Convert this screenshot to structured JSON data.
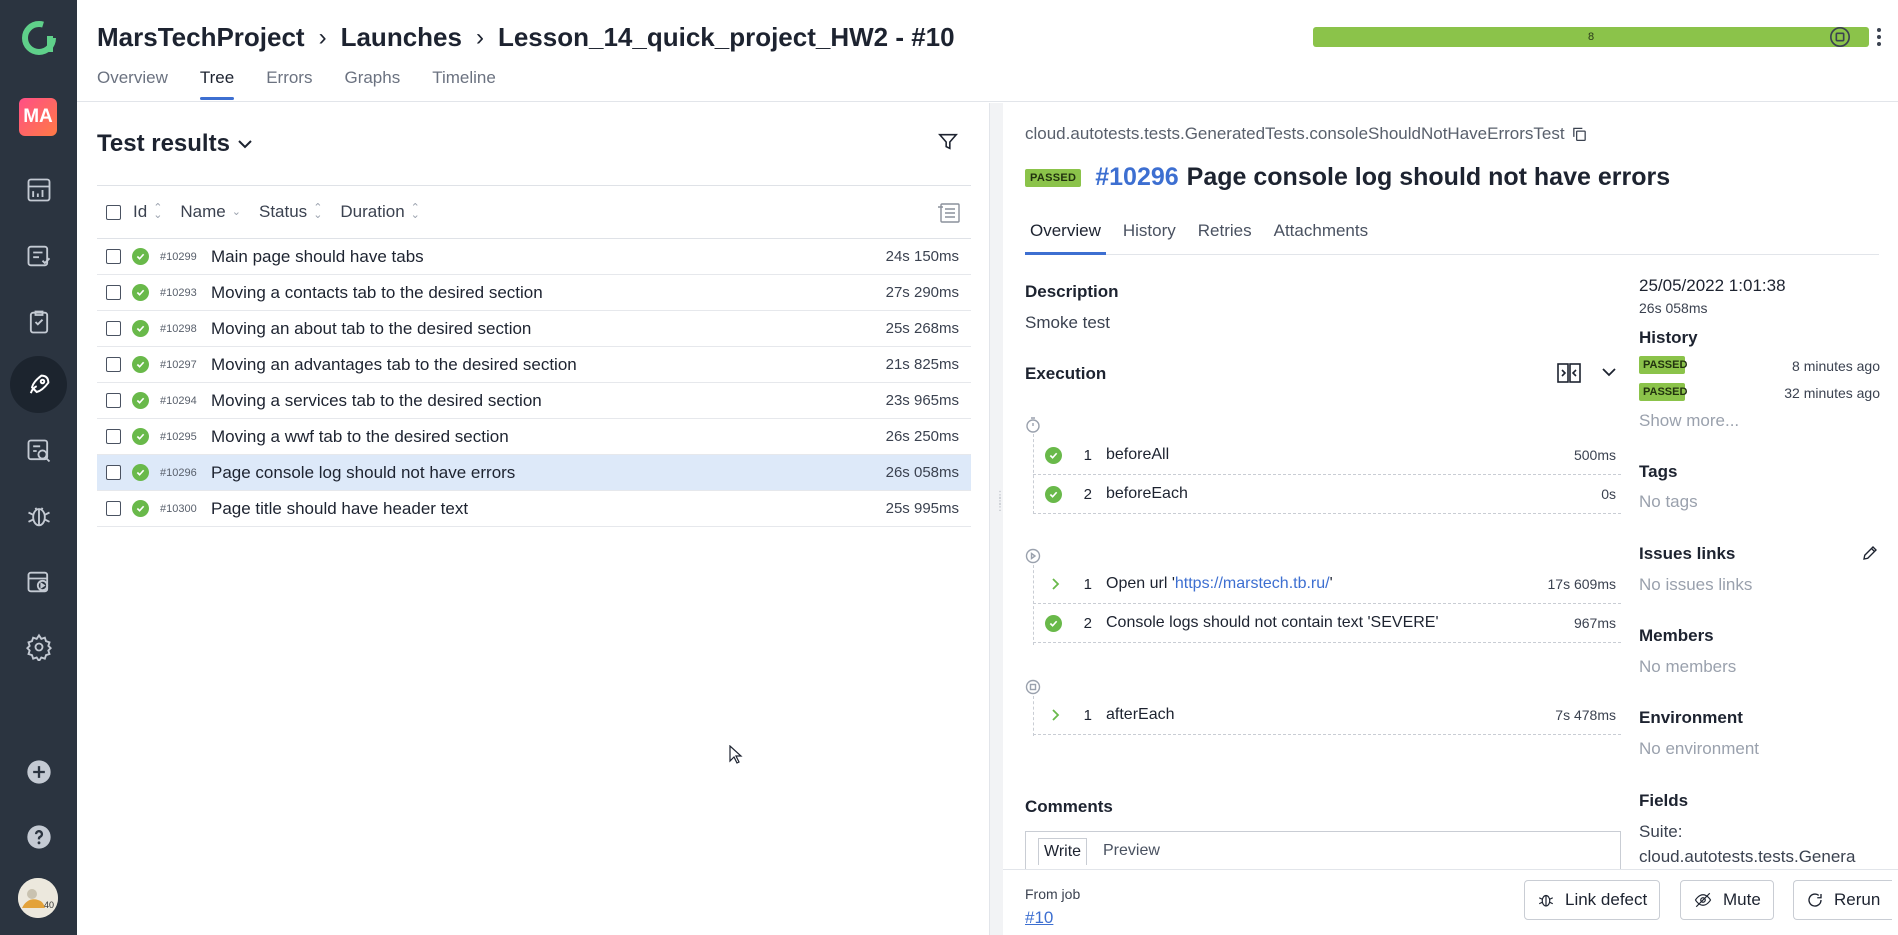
{
  "breadcrumb": {
    "project": "MarsTechProject",
    "launches": "Launches",
    "launch": "Lesson_14_quick_project_HW2 - #10"
  },
  "progress": {
    "label": "8",
    "fill_fraction": 1.0,
    "color": "#8bc34a"
  },
  "tabs": [
    "Overview",
    "Tree",
    "Errors",
    "Graphs",
    "Timeline"
  ],
  "active_tab": "Tree",
  "sidebar": {
    "project_initials": "MA"
  },
  "test_results": {
    "title": "Test results",
    "columns": {
      "id": "Id",
      "name": "Name",
      "status": "Status",
      "duration": "Duration"
    },
    "rows": [
      {
        "id": "#10299",
        "name": "Main page should have tabs",
        "duration": "24s 150ms"
      },
      {
        "id": "#10293",
        "name": "Moving a contacts tab to the desired section",
        "duration": "27s 290ms"
      },
      {
        "id": "#10298",
        "name": "Moving an about tab to the desired section",
        "duration": "25s 268ms"
      },
      {
        "id": "#10297",
        "name": "Moving an advantages tab to the desired section",
        "duration": "21s 825ms"
      },
      {
        "id": "#10294",
        "name": "Moving a services tab to the desired section",
        "duration": "23s 965ms"
      },
      {
        "id": "#10295",
        "name": "Moving a wwf tab to the desired section",
        "duration": "26s 250ms"
      },
      {
        "id": "#10296",
        "name": "Page console log should not have errors",
        "duration": "26s 058ms"
      },
      {
        "id": "#10300",
        "name": "Page title should have header text",
        "duration": "25s 995ms"
      }
    ]
  },
  "detail": {
    "full_name": "cloud.autotests.tests.GeneratedTests.consoleShouldNotHaveErrorsTest",
    "status": "PASSED",
    "number": "#10296",
    "name": "Page console log should not have errors",
    "tabs": [
      "Overview",
      "History",
      "Retries",
      "Attachments"
    ],
    "description_label": "Description",
    "description": "Smoke test",
    "execution_label": "Execution",
    "before_steps": [
      {
        "num": "1",
        "name": "beforeAll",
        "duration": "500ms"
      },
      {
        "num": "2",
        "name": "beforeEach",
        "duration": "0s"
      }
    ],
    "test_steps": [
      {
        "num": "1",
        "name_prefix": "Open url '",
        "url": "https://marstech.tb.ru/",
        "name_suffix": "'",
        "duration": "17s 609ms"
      },
      {
        "num": "2",
        "name": "Console logs should not contain text 'SEVERE'",
        "duration": "967ms"
      }
    ],
    "after_steps": [
      {
        "num": "1",
        "name": "afterEach",
        "duration": "7s 478ms"
      }
    ],
    "comments_label": "Comments",
    "comment_tabs": {
      "write": "Write",
      "preview": "Preview"
    },
    "from_job_label": "From job",
    "from_job_link": "#10",
    "buttons": {
      "link_defect": "Link defect",
      "mute": "Mute",
      "rerun": "Rerun"
    },
    "meta": {
      "date": "25/05/2022 1:01:38",
      "duration": "26s 058ms",
      "history_label": "History",
      "history": [
        {
          "status": "PASSED",
          "ago": "8 minutes ago"
        },
        {
          "status": "PASSED",
          "ago": "32 minutes ago"
        }
      ],
      "show_more": "Show more...",
      "tags_label": "Tags",
      "tags_value": "No tags",
      "issues_label": "Issues links",
      "issues_value": "No issues links",
      "members_label": "Members",
      "members_value": "No members",
      "environment_label": "Environment",
      "environment_value": "No environment",
      "fields_label": "Fields",
      "suite_label": "Suite:",
      "suite_value": "cloud.autotests.tests.Genera"
    }
  }
}
